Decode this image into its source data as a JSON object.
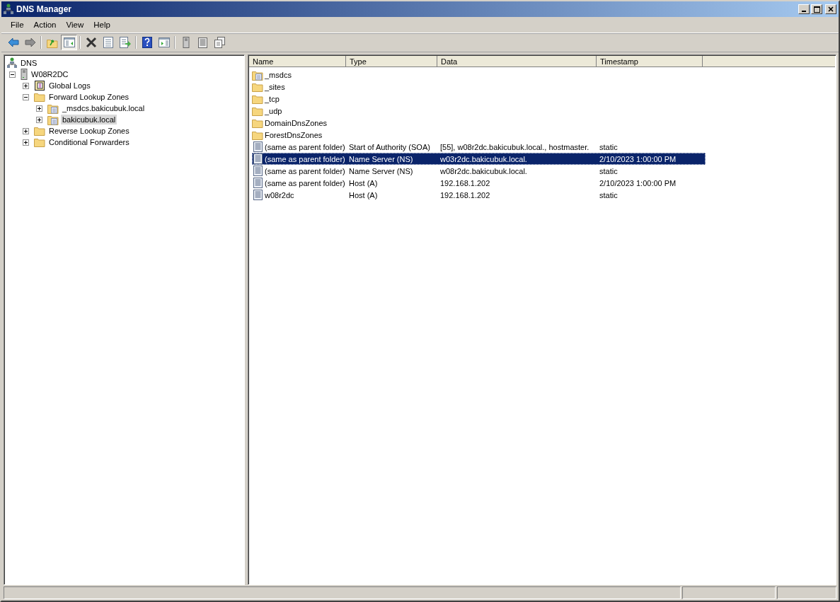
{
  "window": {
    "title": "DNS Manager"
  },
  "menu": [
    "File",
    "Action",
    "View",
    "Help"
  ],
  "toolbar": [
    {
      "kind": "back",
      "pressed": false
    },
    {
      "kind": "forward",
      "pressed": false
    },
    {
      "kind": "sep"
    },
    {
      "kind": "up",
      "pressed": false
    },
    {
      "kind": "tree",
      "pressed": true
    },
    {
      "kind": "sep"
    },
    {
      "kind": "delete",
      "pressed": false
    },
    {
      "kind": "properties",
      "pressed": false
    },
    {
      "kind": "export",
      "pressed": false
    },
    {
      "kind": "sep"
    },
    {
      "kind": "help",
      "pressed": false
    },
    {
      "kind": "action-pane",
      "pressed": false
    },
    {
      "kind": "sep"
    },
    {
      "kind": "server",
      "pressed": false
    },
    {
      "kind": "list",
      "pressed": false
    },
    {
      "kind": "copy",
      "pressed": false
    }
  ],
  "tree": [
    {
      "label": "DNS",
      "kind": "root",
      "selected": false,
      "children": [
        {
          "label": "W08R2DC",
          "kind": "server",
          "expanded": true,
          "selected": false,
          "children": [
            {
              "label": "Global Logs",
              "kind": "log",
              "expanded": false,
              "selected": false
            },
            {
              "label": "Forward Lookup Zones",
              "kind": "folder",
              "expanded": true,
              "selected": false,
              "children": [
                {
                  "label": "_msdcs.bakicubuk.local",
                  "kind": "zone",
                  "expanded": false,
                  "selected": false
                },
                {
                  "label": "bakicubuk.local",
                  "kind": "zone",
                  "expanded": false,
                  "selected": true
                }
              ]
            },
            {
              "label": "Reverse Lookup Zones",
              "kind": "folder",
              "expanded": false,
              "selected": false
            },
            {
              "label": "Conditional Forwarders",
              "kind": "folder",
              "expanded": false,
              "selected": false
            }
          ]
        }
      ]
    }
  ],
  "table": {
    "columns": [
      "Name",
      "Type",
      "Data",
      "Timestamp"
    ],
    "rows": [
      {
        "kind": "zone",
        "selected": false,
        "cells": [
          "_msdcs"
        ]
      },
      {
        "kind": "folder",
        "selected": false,
        "cells": [
          "_sites"
        ]
      },
      {
        "kind": "folder",
        "selected": false,
        "cells": [
          "_tcp"
        ]
      },
      {
        "kind": "folder",
        "selected": false,
        "cells": [
          "_udp"
        ]
      },
      {
        "kind": "folder",
        "selected": false,
        "cells": [
          "DomainDnsZones"
        ]
      },
      {
        "kind": "folder",
        "selected": false,
        "cells": [
          "ForestDnsZones"
        ]
      },
      {
        "kind": "record",
        "selected": false,
        "cells": [
          "(same as parent folder)",
          "Start of Authority (SOA)",
          "[55], w08r2dc.bakicubuk.local., hostmaster.",
          "static"
        ]
      },
      {
        "kind": "record",
        "selected": true,
        "cells": [
          "(same as parent folder)",
          "Name Server (NS)",
          "w03r2dc.bakicubuk.local.",
          "2/10/2023 1:00:00 PM"
        ]
      },
      {
        "kind": "record",
        "selected": false,
        "cells": [
          "(same as parent folder)",
          "Name Server (NS)",
          "w08r2dc.bakicubuk.local.",
          "static"
        ]
      },
      {
        "kind": "record",
        "selected": false,
        "cells": [
          "(same as parent folder)",
          "Host (A)",
          "192.168.1.202",
          "2/10/2023 1:00:00 PM"
        ]
      },
      {
        "kind": "record",
        "selected": false,
        "cells": [
          "w08r2dc",
          "Host (A)",
          "192.168.1.202",
          "static"
        ]
      }
    ]
  }
}
